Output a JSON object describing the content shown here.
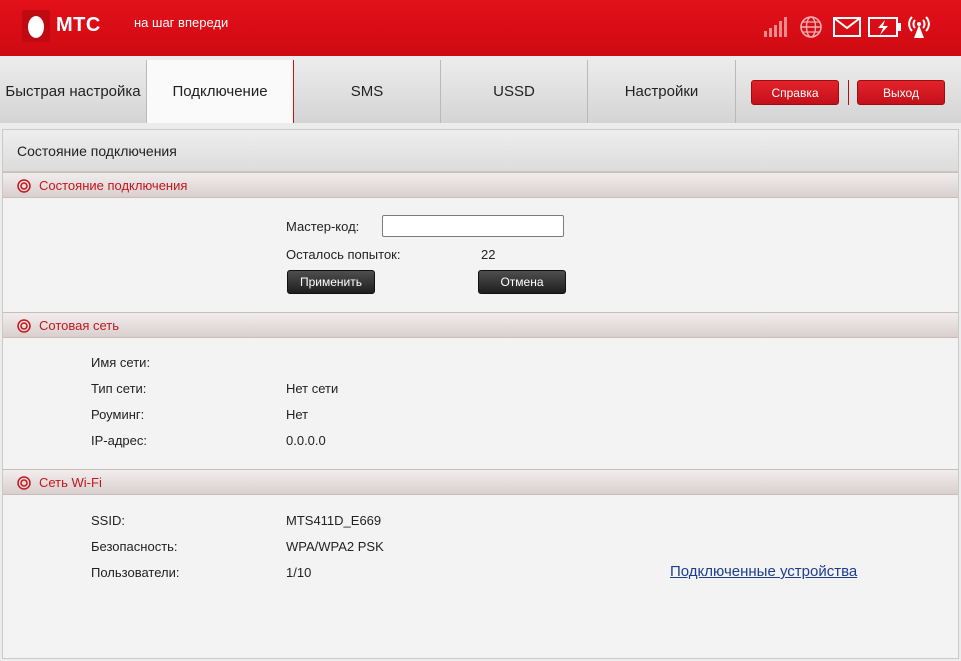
{
  "header": {
    "brand": "МТС",
    "slogan": "на шаг впереди",
    "icons": [
      "signal-bars-icon",
      "globe-icon",
      "envelope-icon",
      "battery-charging-icon",
      "wifi-broadcast-icon"
    ]
  },
  "tabs": [
    {
      "label": "Быстрая настройка",
      "active": false
    },
    {
      "label": "Подключение",
      "active": true
    },
    {
      "label": "SMS",
      "active": false
    },
    {
      "label": "USSD",
      "active": false
    },
    {
      "label": "Настройки",
      "active": false
    }
  ],
  "buttons": {
    "help": "Справка",
    "logout": "Выход"
  },
  "page": {
    "title": "Состояние подключения"
  },
  "sections": {
    "connection": {
      "title": "Состояние подключения",
      "master_code_label": "Мастер-код:",
      "master_code_value": "",
      "attempts_label": "Осталось попыток:",
      "attempts_value": "22",
      "apply": "Применить",
      "cancel": "Отмена"
    },
    "cellular": {
      "title": "Сотовая сеть",
      "rows": [
        {
          "label": "Имя сети:",
          "value": ""
        },
        {
          "label": "Тип сети:",
          "value": "Нет сети"
        },
        {
          "label": "Роуминг:",
          "value": "Нет"
        },
        {
          "label": "IP-адрес:",
          "value": "0.0.0.0"
        }
      ]
    },
    "wifi": {
      "title": "Сеть Wi-Fi",
      "rows": [
        {
          "label": "SSID:",
          "value": "MTS411D_E669"
        },
        {
          "label": "Безопасность:",
          "value": "WPA/WPA2 PSK"
        },
        {
          "label": "Пользователи:",
          "value": "1/10"
        }
      ],
      "devices_link": "Подключенные устройства"
    }
  },
  "colors": {
    "brand_red": "#d50d16",
    "section_title_red": "#c4161c",
    "link_blue": "#1d3e8f"
  }
}
